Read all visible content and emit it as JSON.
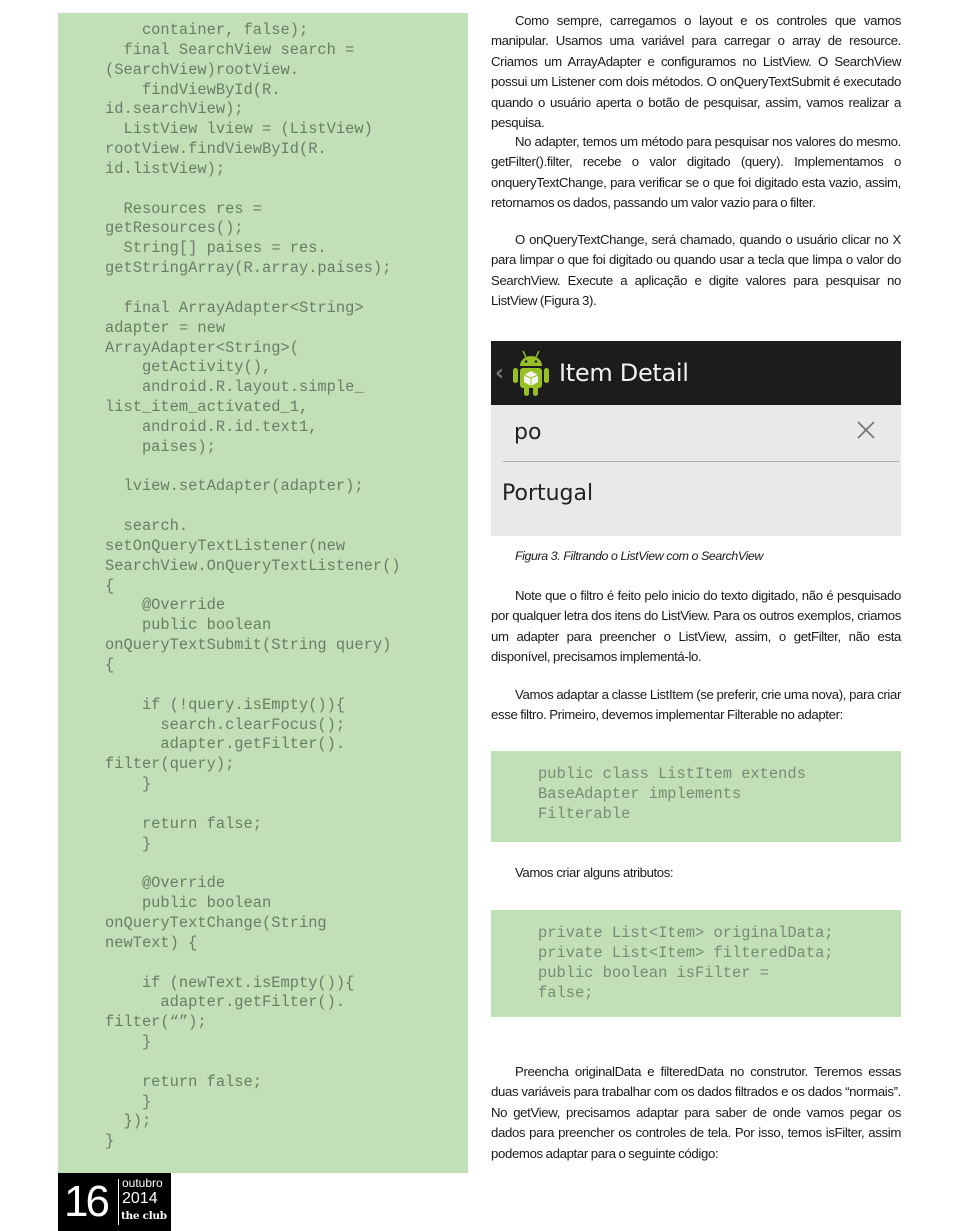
{
  "left_code": {
    "lines": [
      "    container, false);",
      "  final SearchView search =",
      "(SearchView)rootView.",
      "    findViewById(R.",
      "id.searchView);",
      "  ListView lview = (ListView)",
      "rootView.findViewById(R.",
      "id.listView);",
      "",
      "  Resources res =",
      "getResources();",
      "  String[] paises = res.",
      "getStringArray(R.array.paises);",
      "",
      "  final ArrayAdapter<String>",
      "adapter = new",
      "ArrayAdapter<String>(",
      "    getActivity(),",
      "    android.R.layout.simple_",
      "list_item_activated_1,",
      "    android.R.id.text1,",
      "    paises);",
      "",
      "  lview.setAdapter(adapter);",
      "",
      "  search.",
      "setOnQueryTextListener(new",
      "SearchView.OnQueryTextListener()",
      "{",
      "    @Override",
      "    public boolean",
      "onQueryTextSubmit(String query)",
      "{",
      "",
      "    if (!query.isEmpty()){",
      "      search.clearFocus();",
      "      adapter.getFilter().",
      "filter(query);",
      "    }",
      "",
      "    return false;",
      "    }",
      "",
      "    @Override",
      "    public boolean",
      "onQueryTextChange(String",
      "newText) {",
      "",
      "    if (newText.isEmpty()){",
      "      adapter.getFilter().",
      "filter(“”);",
      "    }",
      "",
      "    return false;",
      "    }",
      "  });",
      "}"
    ]
  },
  "paragraphs": [
    "Como sempre, carregamos o layout e os controles que vamos manipular. Usamos uma variável para carregar o array de resource. Criamos um ArrayAdapter e configuramos no ListView. O SearchView possui um Listener com dois métodos. O onQueryTextSubmit é executado quando o usuário aperta o botão de pesquisar, assim, vamos realizar a pesquisa.",
    "No adapter, temos um método para pesquisar nos valores do mesmo. getFilter().filter, recebe o valor digitado (query). Implementamos o onqueryTextChange, para verificar se o que foi digitado esta vazio, assim, retornamos os dados, passando um valor vazio para o filter.",
    "O onQueryTextChange, será chamado, quando o usuário clicar no X para limpar o que foi digitado ou quando usar a tecla que limpa o valor do SearchView. Execute a aplicação e digite valores para pesquisar no ListView (Figura 3).",
    "Note que o filtro é feito pelo inicio do texto digitado, não é pesquisado por qualquer letra dos itens do ListView. Para os outros exemplos, criamos um adapter para preencher o ListView, assim, o getFilter, não esta disponível, precisamos implementá-lo.",
    "Vamos adaptar a classe ListItem (se preferir, crie uma nova), para criar esse filtro. Primeiro, devemos implementar Filterable no adapter:",
    "Preencha originalData e filteredData no construtor. Teremos essas duas variáveis para trabalhar com os dados filtrados e os dados “normais”. No getView, precisamos adaptar para saber de onde vamos pegar os dados para preencher os controles de tela. Por isso, temos isFilter, assim podemos adaptar para o seguinte código:"
  ],
  "figure": {
    "actionbar_title": "Item Detail",
    "back_icon": "chevron-left-icon",
    "app_icon": "android-icon",
    "search_value": "po",
    "clear_icon": "close-icon",
    "list_items": [
      "Portugal"
    ],
    "caption": "Figura 3. Filtrando o ListView com o SearchView"
  },
  "code_box_1": {
    "lines": [
      "public class ListItem extends",
      "BaseAdapter implements",
      "Filterable"
    ]
  },
  "attributes_label": "Vamos criar alguns atributos:",
  "code_box_2": {
    "lines": [
      "private List<Item> originalData;",
      "private List<Item> filteredData;",
      "public boolean isFilter =",
      "false;"
    ]
  },
  "footer": {
    "page_number": "16",
    "month": "outubro",
    "year": "2014",
    "brand": "the club"
  },
  "colors": {
    "code_background": "#c2e0b7",
    "code_text": "#6b7d66",
    "actionbar": "#1c1c1c",
    "android_green": "#97c024"
  }
}
